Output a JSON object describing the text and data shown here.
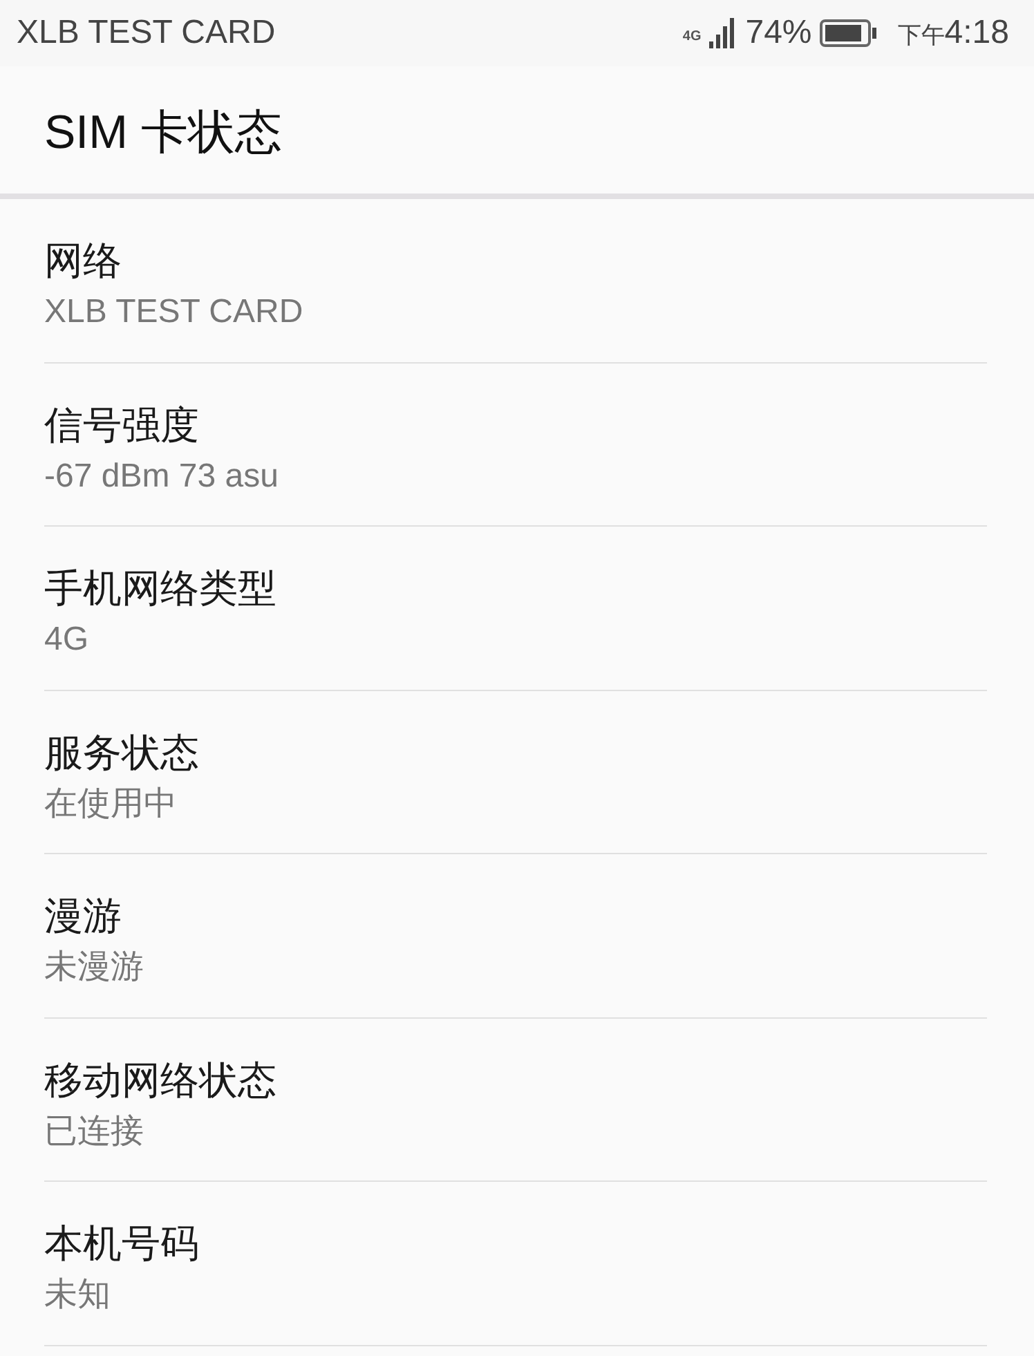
{
  "status_bar": {
    "carrier": "XLB TEST CARD",
    "network": "4G",
    "battery": "74%",
    "period": "下午",
    "time": "4:18"
  },
  "header": {
    "title": "SIM 卡状态"
  },
  "items": [
    {
      "label": "网络",
      "value": "XLB TEST CARD"
    },
    {
      "label": "信号强度",
      "value": "-67 dBm 73 asu"
    },
    {
      "label": "手机网络类型",
      "value": "4G"
    },
    {
      "label": "服务状态",
      "value": "在使用中"
    },
    {
      "label": "漫游",
      "value": "未漫游"
    },
    {
      "label": "移动网络状态",
      "value": "已连接"
    },
    {
      "label": "本机号码",
      "value": "未知"
    }
  ]
}
